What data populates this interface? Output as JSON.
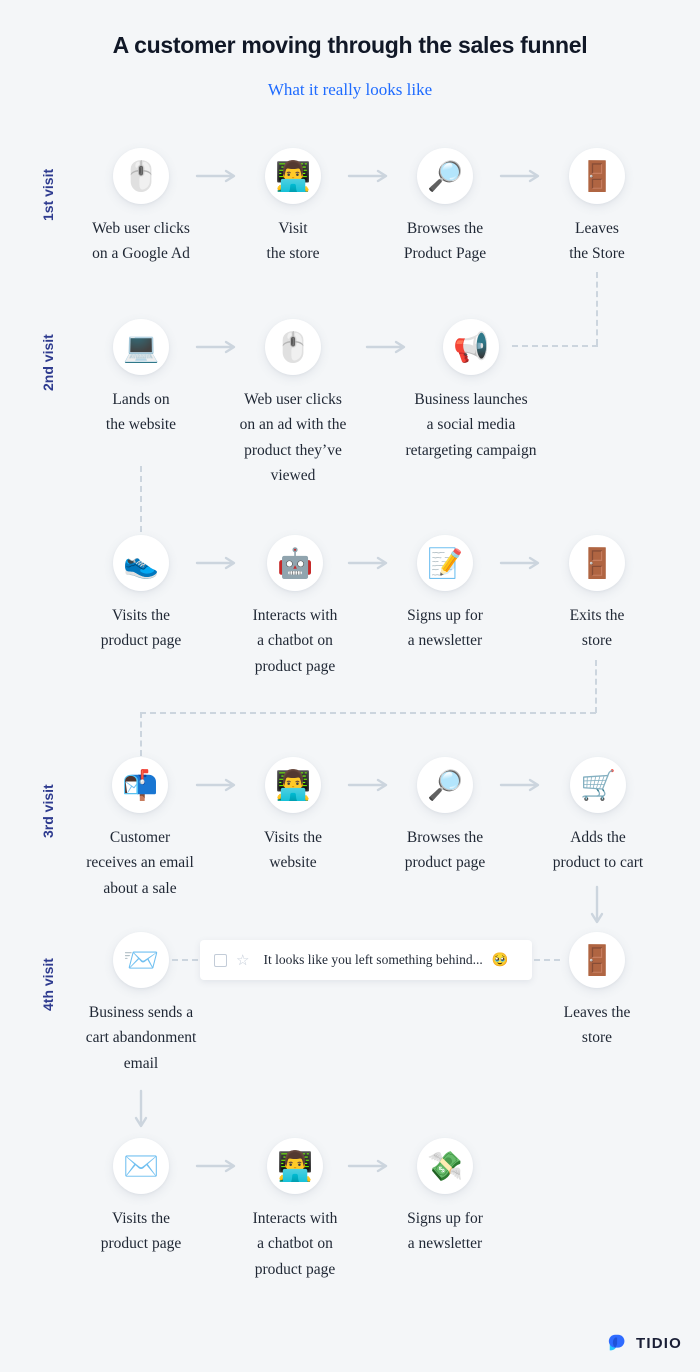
{
  "header": {
    "title": "A customer moving through the sales funnel",
    "subtitle": "What it really looks like",
    "title_color": "#111827",
    "subtitle_color": "#1e6bff"
  },
  "theme": {
    "background": "#f4f6f8",
    "visit_label_color": "#2e3b8f",
    "arrow_color": "#ccd5de",
    "dash_color": "#ccd5de",
    "bubble_background": "#ffffff",
    "text_color": "#1f2734"
  },
  "visits": [
    {
      "label": "1st visit"
    },
    {
      "label": "2nd visit"
    },
    {
      "label": "3rd visit"
    },
    {
      "label": "4th visit"
    }
  ],
  "steps": {
    "r1c1": {
      "icon": "🖱️",
      "icon_name": "computer-mouse-icon",
      "label": "Web user clicks\non a Google Ad"
    },
    "r1c2": {
      "icon": "👨‍💻",
      "icon_name": "man-at-laptop-icon",
      "label": "Visit\nthe store"
    },
    "r1c3": {
      "icon": "🔎",
      "icon_name": "magnifying-glass-icon",
      "label": "Browses the\nProduct Page"
    },
    "r1c4": {
      "icon": "🚪",
      "icon_name": "door-icon",
      "label": "Leaves\nthe Store"
    },
    "r2c1": {
      "icon": "💻",
      "icon_name": "laptop-icon",
      "label": "Lands on\nthe website"
    },
    "r2c2": {
      "icon": "🖱️",
      "icon_name": "computer-mouse-icon",
      "label": "Web user clicks\non an ad with the\nproduct they’ve\nviewed"
    },
    "r2c3": {
      "icon": "📢",
      "icon_name": "megaphone-icon",
      "label": "Business launches\na social media\nretargeting campaign"
    },
    "r3c1": {
      "icon": "👟",
      "icon_name": "sneaker-icon",
      "label": "Visits the\nproduct page"
    },
    "r3c2": {
      "icon": "🤖",
      "icon_name": "robot-icon",
      "label": "Interacts with\na chatbot on\nproduct page"
    },
    "r3c3": {
      "icon": "📝",
      "icon_name": "memo-icon",
      "label": "Signs up for\na newsletter"
    },
    "r3c4": {
      "icon": "🚪",
      "icon_name": "door-icon",
      "label": "Exits the\nstore"
    },
    "r4c1": {
      "icon": "📬",
      "icon_name": "mailbox-icon",
      "label": "Customer\nreceives an email\nabout a sale"
    },
    "r4c2": {
      "icon": "👨‍💻",
      "icon_name": "man-at-laptop-icon",
      "label": "Visits the\nwebsite"
    },
    "r4c3": {
      "icon": "🔎",
      "icon_name": "magnifying-glass-icon",
      "label": "Browses the\nproduct page"
    },
    "r4c4": {
      "icon": "🛒",
      "icon_name": "shopping-cart-icon",
      "label": "Adds the\nproduct to cart"
    },
    "r5c1": {
      "icon": "📨",
      "icon_name": "incoming-envelope-icon",
      "label": "Business sends a\ncart abandonment\nemail"
    },
    "r5c4": {
      "icon": "🚪",
      "icon_name": "door-icon",
      "label": "Leaves the\nstore"
    },
    "r6c1": {
      "icon": "✉️",
      "icon_name": "envelope-icon",
      "label": "Visits the\nproduct page"
    },
    "r6c2": {
      "icon": "👨‍💻",
      "icon_name": "man-at-laptop-icon",
      "label": "Interacts with\na chatbot on\nproduct page"
    },
    "r6c3": {
      "icon": "💸",
      "icon_name": "money-with-wings-icon",
      "label": "Signs up for\na newsletter"
    }
  },
  "email_card": {
    "text": "It looks like you left something behind...",
    "emoji": "🥹",
    "star": "☆"
  },
  "footer": {
    "brand": "TIDIO",
    "brand_color": "#1a1f36",
    "mark_colors": [
      "#2f6bff",
      "#23c8ff"
    ]
  }
}
